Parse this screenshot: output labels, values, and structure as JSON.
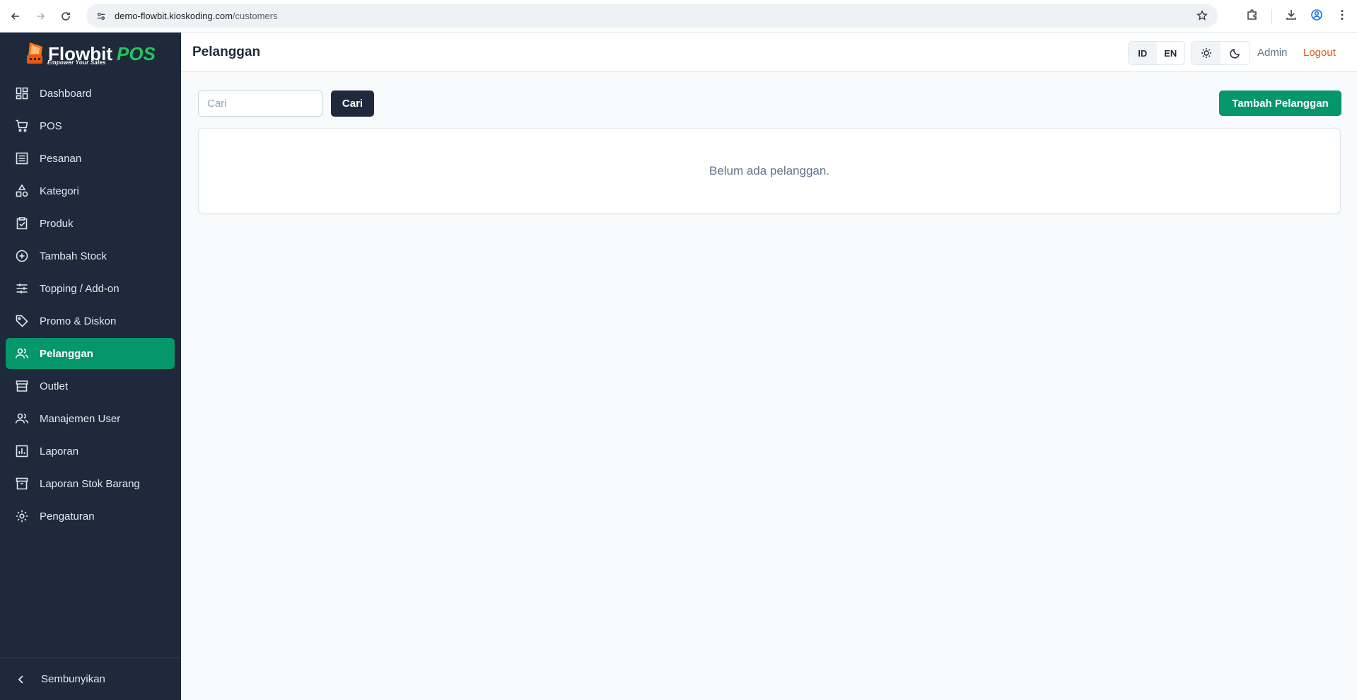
{
  "browser": {
    "url_host": "demo-flowbit.kioskoding.com",
    "url_path": "/customers"
  },
  "brand": {
    "name_main": "Flowbit",
    "name_accent": "POS",
    "tagline": "Empower Your Sales",
    "accent_color": "#22c55e"
  },
  "sidebar": {
    "items": [
      {
        "label": "Dashboard",
        "icon": "dashboard-icon"
      },
      {
        "label": "POS",
        "icon": "cart-icon"
      },
      {
        "label": "Pesanan",
        "icon": "list-icon"
      },
      {
        "label": "Kategori",
        "icon": "shapes-icon"
      },
      {
        "label": "Produk",
        "icon": "clipboard-check-icon"
      },
      {
        "label": "Tambah Stock",
        "icon": "plus-circle-icon"
      },
      {
        "label": "Topping / Add-on",
        "icon": "sliders-icon"
      },
      {
        "label": "Promo & Diskon",
        "icon": "tag-icon"
      },
      {
        "label": "Pelanggan",
        "icon": "users-icon",
        "active": true
      },
      {
        "label": "Outlet",
        "icon": "store-icon"
      },
      {
        "label": "Manajemen User",
        "icon": "users-icon"
      },
      {
        "label": "Laporan",
        "icon": "chart-icon"
      },
      {
        "label": "Laporan Stok Barang",
        "icon": "archive-icon"
      },
      {
        "label": "Pengaturan",
        "icon": "gear-icon"
      }
    ],
    "collapse_label": "Sembunyikan",
    "active_color": "#059669"
  },
  "header": {
    "title": "Pelanggan",
    "lang_id": "ID",
    "lang_en": "EN",
    "user": "Admin",
    "logout": "Logout"
  },
  "main": {
    "search_placeholder": "Cari",
    "search_button": "Cari",
    "add_button": "Tambah Pelanggan",
    "empty_message": "Belum ada pelanggan."
  }
}
